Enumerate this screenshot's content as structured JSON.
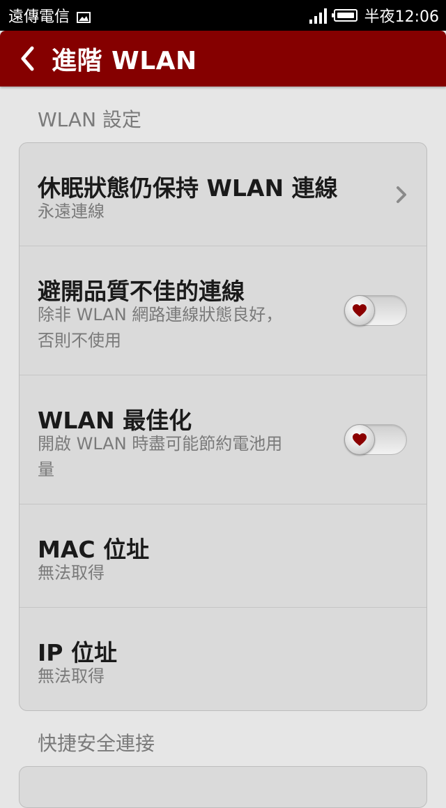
{
  "status_bar": {
    "carrier": "遠傳電信",
    "time": "半夜12:06"
  },
  "header": {
    "title": "進階 WLAN"
  },
  "sections": [
    {
      "header": "WLAN 設定"
    },
    {
      "header": "快捷安全連接"
    }
  ],
  "settings": [
    {
      "title": "休眠狀態仍保持 WLAN 連線",
      "subtitle": "永遠連線",
      "control": "chevron"
    },
    {
      "title": "避開品質不佳的連線",
      "subtitle": "除非 WLAN 網路連線狀態良好，\n否則不使用",
      "control": "toggle",
      "on": false
    },
    {
      "title": "WLAN 最佳化",
      "subtitle": "開啟 WLAN 時盡可能節約電池用\n量",
      "control": "toggle",
      "on": false
    },
    {
      "title": "MAC 位址",
      "subtitle": "無法取得"
    },
    {
      "title": "IP 位址",
      "subtitle": "無法取得"
    }
  ],
  "colors": {
    "header_bg": "#850000",
    "toggle_heart": "#8b0000"
  }
}
